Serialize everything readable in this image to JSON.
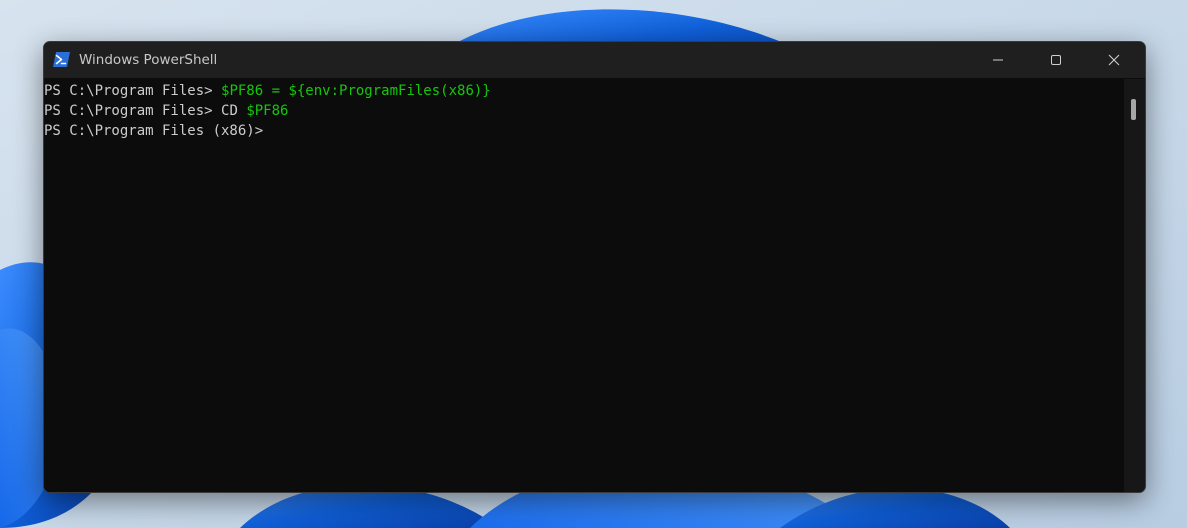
{
  "window": {
    "title": "Windows PowerShell",
    "app_icon": "powershell-icon",
    "controls": {
      "minimize_icon": "minimize-icon",
      "maximize_icon": "maximize-icon",
      "close_icon": "close-icon"
    }
  },
  "console": {
    "lines": [
      {
        "prompt": "PS C:\\Program Files> ",
        "command": "$PF86 = ${env:ProgramFiles(x86)}",
        "command_color": "#16c60c"
      },
      {
        "prompt": "PS C:\\Program Files> ",
        "command_keyword": "CD ",
        "command_arg": "$PF86",
        "keyword_color": "#cccccc",
        "arg_color": "#16c60c"
      },
      {
        "prompt": "PS C:\\Program Files (x86)>"
      }
    ]
  },
  "colors": {
    "console_bg": "#0c0c0c",
    "titlebar_bg": "#1f1f1f",
    "text": "#cccccc",
    "green": "#16c60c",
    "wallpaper_bg": "#c9d9ea",
    "wallpaper_accent": "#1565e0"
  }
}
